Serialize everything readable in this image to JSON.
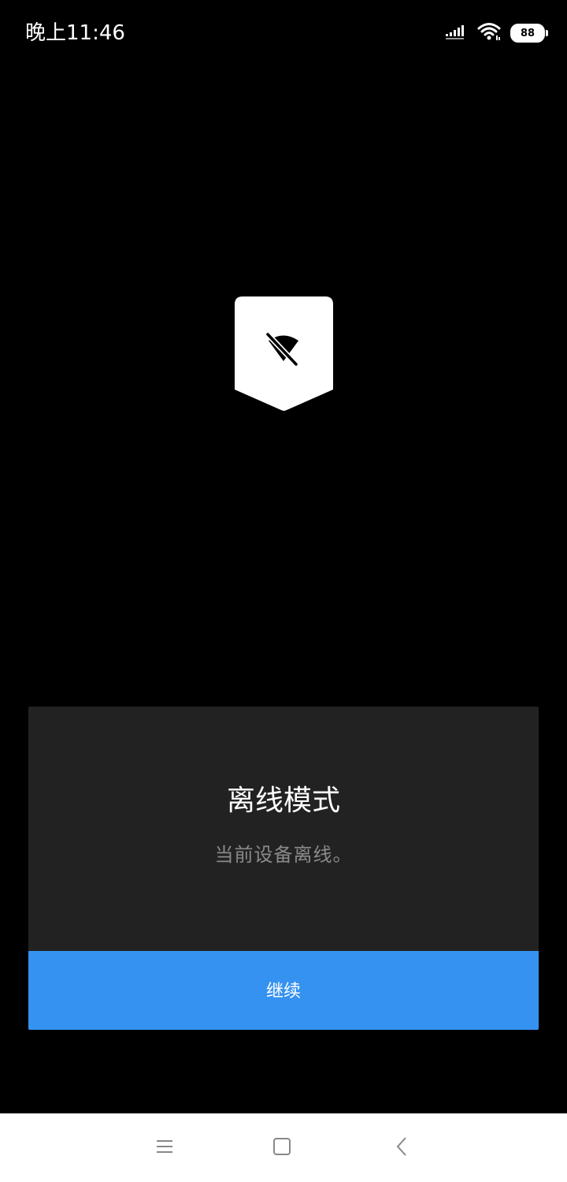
{
  "status_bar": {
    "time": "晚上11:46",
    "battery_level": "88",
    "icons": [
      "signal-icon",
      "wifi-icon",
      "battery-icon"
    ]
  },
  "badge": {
    "icon": "wifi-off-icon"
  },
  "dialog": {
    "title": "离线模式",
    "message": "当前设备离线。",
    "continue_label": "继续"
  },
  "nav_bar": {
    "icons": [
      "menu-icon",
      "home-icon",
      "back-icon"
    ]
  },
  "colors": {
    "background": "#000000",
    "dialog_background": "#222222",
    "accent": "#3592f0",
    "message_text": "#8a8a8a",
    "nav_background": "#ffffff"
  }
}
